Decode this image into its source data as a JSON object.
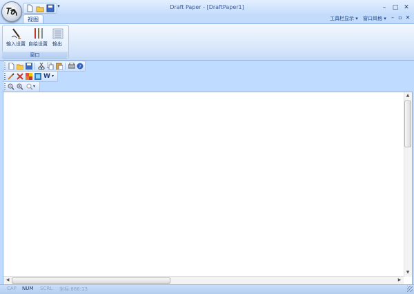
{
  "app": {
    "window_title": "Draft Paper - [DraftPaper1]"
  },
  "window_controls": {
    "minimize": "–",
    "maximize": "□",
    "close": "✕"
  },
  "quick_access": {
    "more": "▾"
  },
  "ribbon": {
    "tabs": [
      {
        "label": "视图"
      }
    ],
    "right_menu": {
      "toolbar_display": "工具栏显示 ▾",
      "window_style": "窗口风格 ▾"
    },
    "mdi_controls": {
      "minimize": "–",
      "restore": "▫",
      "close": "✕"
    },
    "group": {
      "label": "窗口",
      "buttons": [
        {
          "label": "输入设置",
          "icon": "pen-input-icon"
        },
        {
          "label": "自绘设置",
          "icon": "pencils-icon"
        },
        {
          "label": "输出",
          "icon": "output-lines-icon"
        }
      ]
    }
  },
  "toolbars": {
    "format_text": "W"
  },
  "scrollbar": {
    "up": "▲",
    "down": "▼",
    "left": "◀",
    "right": "▶"
  },
  "status": {
    "cap": "CAP",
    "num": "NUM",
    "scrl": "SCRL",
    "coords": "坐标:886:13"
  },
  "colors": {
    "frame": "#bfdbff",
    "ribbon_text": "#15428b",
    "document": "#ffffff"
  }
}
